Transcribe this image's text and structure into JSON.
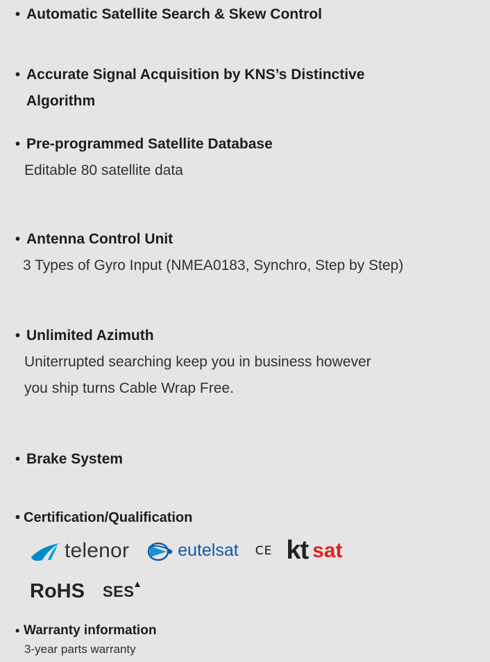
{
  "features": [
    {
      "title": "Automatic Satellite Search & Skew Control",
      "details": []
    },
    {
      "title": "Accurate Signal Acquisition by KNS’s Distinctive",
      "title_line2": "Algorithm",
      "details": []
    },
    {
      "title": "Pre-programmed Satellite Database",
      "details": [
        "Editable 80 satellite data"
      ]
    },
    {
      "title": "Antenna Control Unit",
      "details": [
        "3 Types of Gyro Input (NMEA0183, Synchro, Step by Step)"
      ]
    },
    {
      "title": "Unlimited Azimuth",
      "details": [
        "Uniterrupted searching keep you in business however",
        "you ship turns Cable Wrap Free."
      ]
    },
    {
      "title": "Brake System",
      "details": []
    },
    {
      "title": "Certification/Qualification",
      "details": []
    },
    {
      "title": "Warranty information",
      "details": [
        "3-year parts warranty"
      ]
    }
  ],
  "bullet": "•",
  "logos": {
    "telenor": {
      "text": "telenor",
      "icon": "telenor-swoosh-icon",
      "color": "#0088cc"
    },
    "eutelsat": {
      "text": "eutelsat",
      "icon": "eutelsat-globe-icon",
      "color": "#0f5aa8"
    },
    "ce": {
      "text": "CE"
    },
    "ktsat": {
      "kt": "kt",
      "sat": "sat",
      "color_sat": "#e2211c"
    },
    "rohs": {
      "text": "RoHS"
    },
    "ses": {
      "text": "SES",
      "icon": "ses-triangle-icon"
    }
  }
}
